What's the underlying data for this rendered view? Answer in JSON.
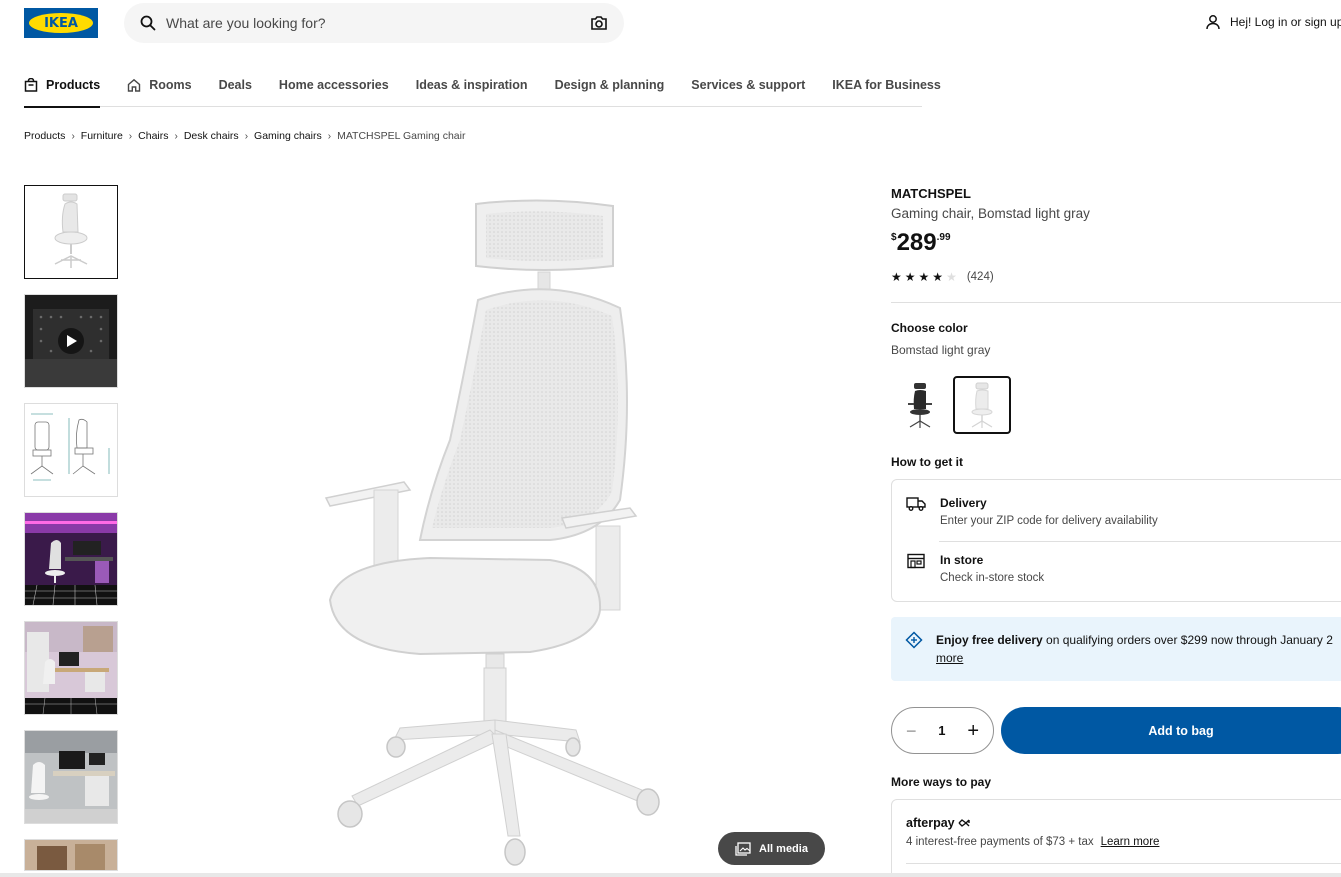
{
  "header": {
    "logo_text": "IKEA",
    "search_placeholder": "What are you looking for?",
    "login_label": "Hej! Log in or sign up"
  },
  "nav": {
    "items": [
      {
        "label": "Products",
        "icon": "bag-icon",
        "active": true
      },
      {
        "label": "Rooms",
        "icon": "house-icon",
        "active": false
      },
      {
        "label": "Deals",
        "active": false
      },
      {
        "label": "Home accessories",
        "active": false
      },
      {
        "label": "Ideas & inspiration",
        "active": false
      },
      {
        "label": "Design & planning",
        "active": false
      },
      {
        "label": "Services & support",
        "active": false
      },
      {
        "label": "IKEA for Business",
        "active": false
      }
    ]
  },
  "breadcrumb": [
    "Products",
    "Furniture",
    "Chairs",
    "Desk chairs",
    "Gaming chairs",
    "MATCHSPEL Gaming chair"
  ],
  "gallery": {
    "all_media_label": "All media"
  },
  "product": {
    "name": "MATCHSPEL",
    "description": "Gaming chair, Bomstad light gray",
    "price_currency": "$",
    "price_integer": "289",
    "price_decimal": ".99",
    "rating_stars": 4,
    "rating_count": "(424)"
  },
  "color": {
    "label": "Choose color",
    "selected": "Bomstad light gray"
  },
  "fulfillment": {
    "label": "How to get it",
    "delivery_title": "Delivery",
    "delivery_sub": "Enter your ZIP code for delivery availability",
    "store_title": "In store",
    "store_sub": "Check in-store stock"
  },
  "promo": {
    "bold": "Enjoy free delivery",
    "text": " on qualifying orders over $299 now through January 2",
    "link": "more"
  },
  "cart": {
    "quantity": "1",
    "add_label": "Add to bag"
  },
  "payment": {
    "label": "More ways to pay",
    "provider": "afterpay",
    "line": "4 interest-free payments of $73 + tax",
    "link": "Learn more"
  },
  "colors": {
    "brand_blue": "#0058a3",
    "brand_yellow": "#ffdb00",
    "promo_bg": "#e9f4fc"
  }
}
